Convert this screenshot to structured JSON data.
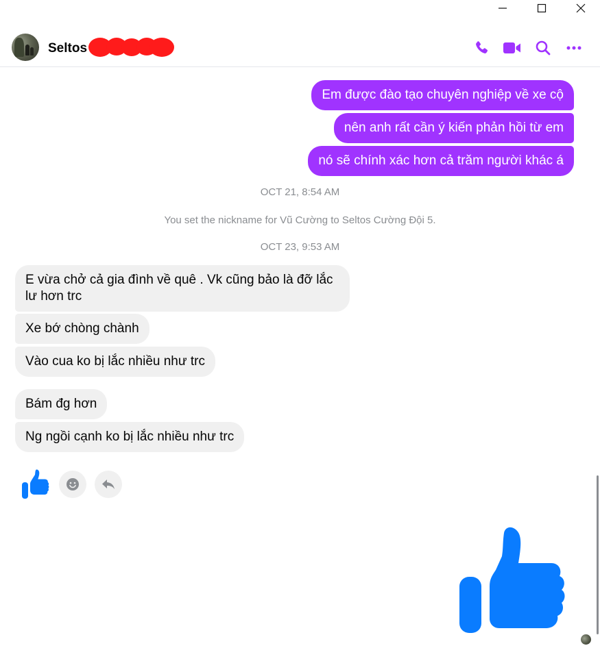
{
  "window": {
    "controls": [
      "minimize",
      "maximize",
      "close"
    ]
  },
  "header": {
    "contact_name": "Seltos",
    "actions": [
      "phone-icon",
      "video-camera-icon",
      "search-icon",
      "more-options-icon"
    ],
    "accent_color": "#a033ff"
  },
  "messages": {
    "outgoing": [
      "Em được đào tạo chuyên nghiệp về xe cộ",
      "nên anh rất cần ý kiến phản hồi từ em",
      "nó sẽ chính xác hơn cả trăm người khác á"
    ],
    "timestamp_1": "OCT 21, 8:54 AM",
    "system_note": "You set the nickname for Vũ Cường to Seltos Cường Đội 5.",
    "timestamp_2": "OCT 23, 9:53 AM",
    "incoming_group_1": [
      "E vừa chở cả gia đình về quê . Vk cũng bảo là đỡ lắc lư hơn trc",
      "Xe bớ chòng chành",
      "Vào cua ko bị lắc nhiều như trc"
    ],
    "incoming_group_2": [
      "Bám đg hơn",
      "Ng ngồi cạnh ko bị lắc nhiều như trc"
    ]
  },
  "reactions": {
    "items": [
      "thumbs-up-icon",
      "smiley-icon",
      "reply-icon"
    ],
    "like_color": "#0a7cff"
  },
  "composer": {
    "big_like": "thumbs-up-icon"
  }
}
